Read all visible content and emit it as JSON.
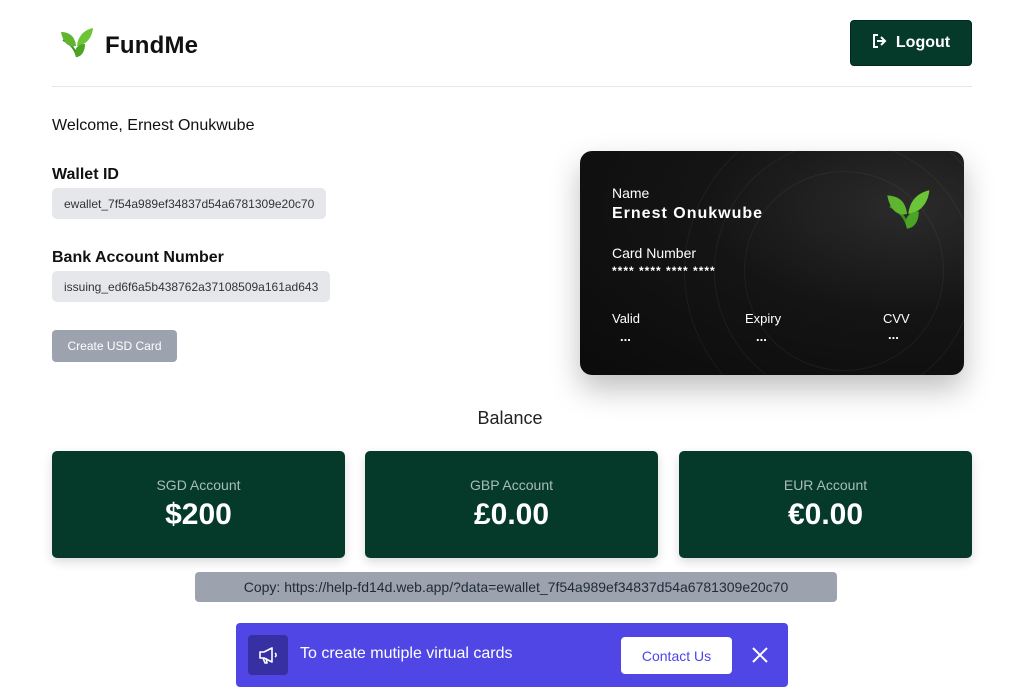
{
  "header": {
    "brand": "FundMe",
    "logout_label": "Logout"
  },
  "user": {
    "welcome": "Welcome, Ernest Onukwube"
  },
  "wallet": {
    "wallet_id_label": "Wallet ID",
    "wallet_id": "ewallet_7f54a989ef34837d54a6781309e20c70",
    "bank_label": "Bank Account Number",
    "bank_number": "issuing_ed6f6a5b438762a37108509a161ad643",
    "create_card_label": "Create USD Card"
  },
  "card": {
    "name_label": "Name",
    "name": "Ernest Onukwube",
    "number_label": "Card Number",
    "number": "**** **** **** ****",
    "valid_label": "Valid",
    "valid_value": "...",
    "expiry_label": "Expiry",
    "expiry_value": "...",
    "cvv_label": "CVV",
    "cvv_value": "..."
  },
  "balance": {
    "title": "Balance",
    "accounts": [
      {
        "label": "SGD Account",
        "value": "$200"
      },
      {
        "label": "GBP Account",
        "value": "£0.00"
      },
      {
        "label": "EUR Account",
        "value": "€0.00"
      }
    ]
  },
  "copy_bar": {
    "text": "Copy: https://help-fd14d.web.app/?data=ewallet_7f54a989ef34837d54a6781309e20c70"
  },
  "promo": {
    "text": "To create mutiple virtual cards",
    "contact_label": "Contact Us"
  },
  "colors": {
    "primary_green": "#05392a",
    "leaf_green": "#5fb52f",
    "promo_indigo": "#4f46e5",
    "pill_gray": "#e5e7eb",
    "button_gray": "#9ca3af"
  },
  "icons": {
    "brand": "leaf-icon",
    "logout": "logout-icon",
    "promo": "megaphone-icon",
    "close": "close-icon"
  }
}
